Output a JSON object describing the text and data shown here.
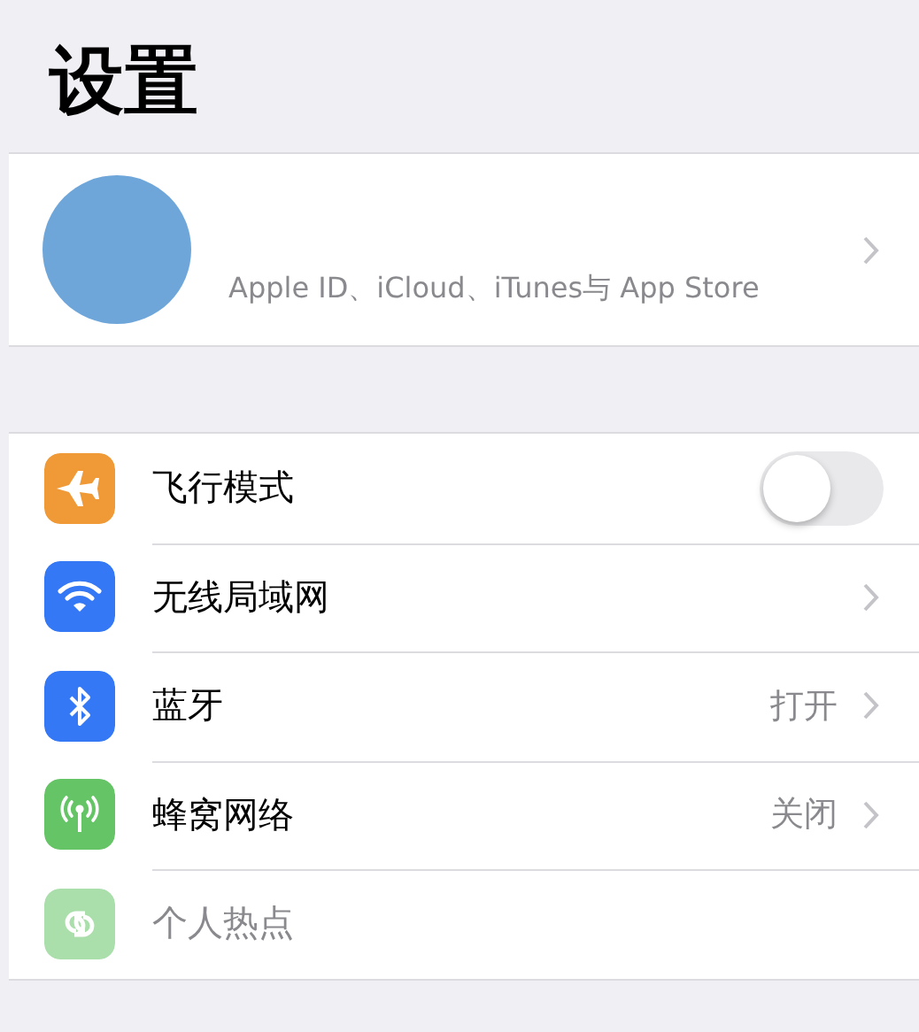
{
  "title": "设置",
  "profile": {
    "subtitle": "Apple ID、iCloud、iTunes与 App Store"
  },
  "rows": [
    {
      "kind": "toggle",
      "label": "飞行模式",
      "on": false,
      "disabled": false
    },
    {
      "kind": "link",
      "label": "无线局域网",
      "disabled": false
    },
    {
      "kind": "link",
      "label": "蓝牙",
      "value": "打开",
      "disabled": false
    },
    {
      "kind": "link",
      "label": "蜂窝网络",
      "value": "关闭",
      "disabled": false
    },
    {
      "kind": "plain",
      "label": "个人热点",
      "disabled": true
    }
  ]
}
